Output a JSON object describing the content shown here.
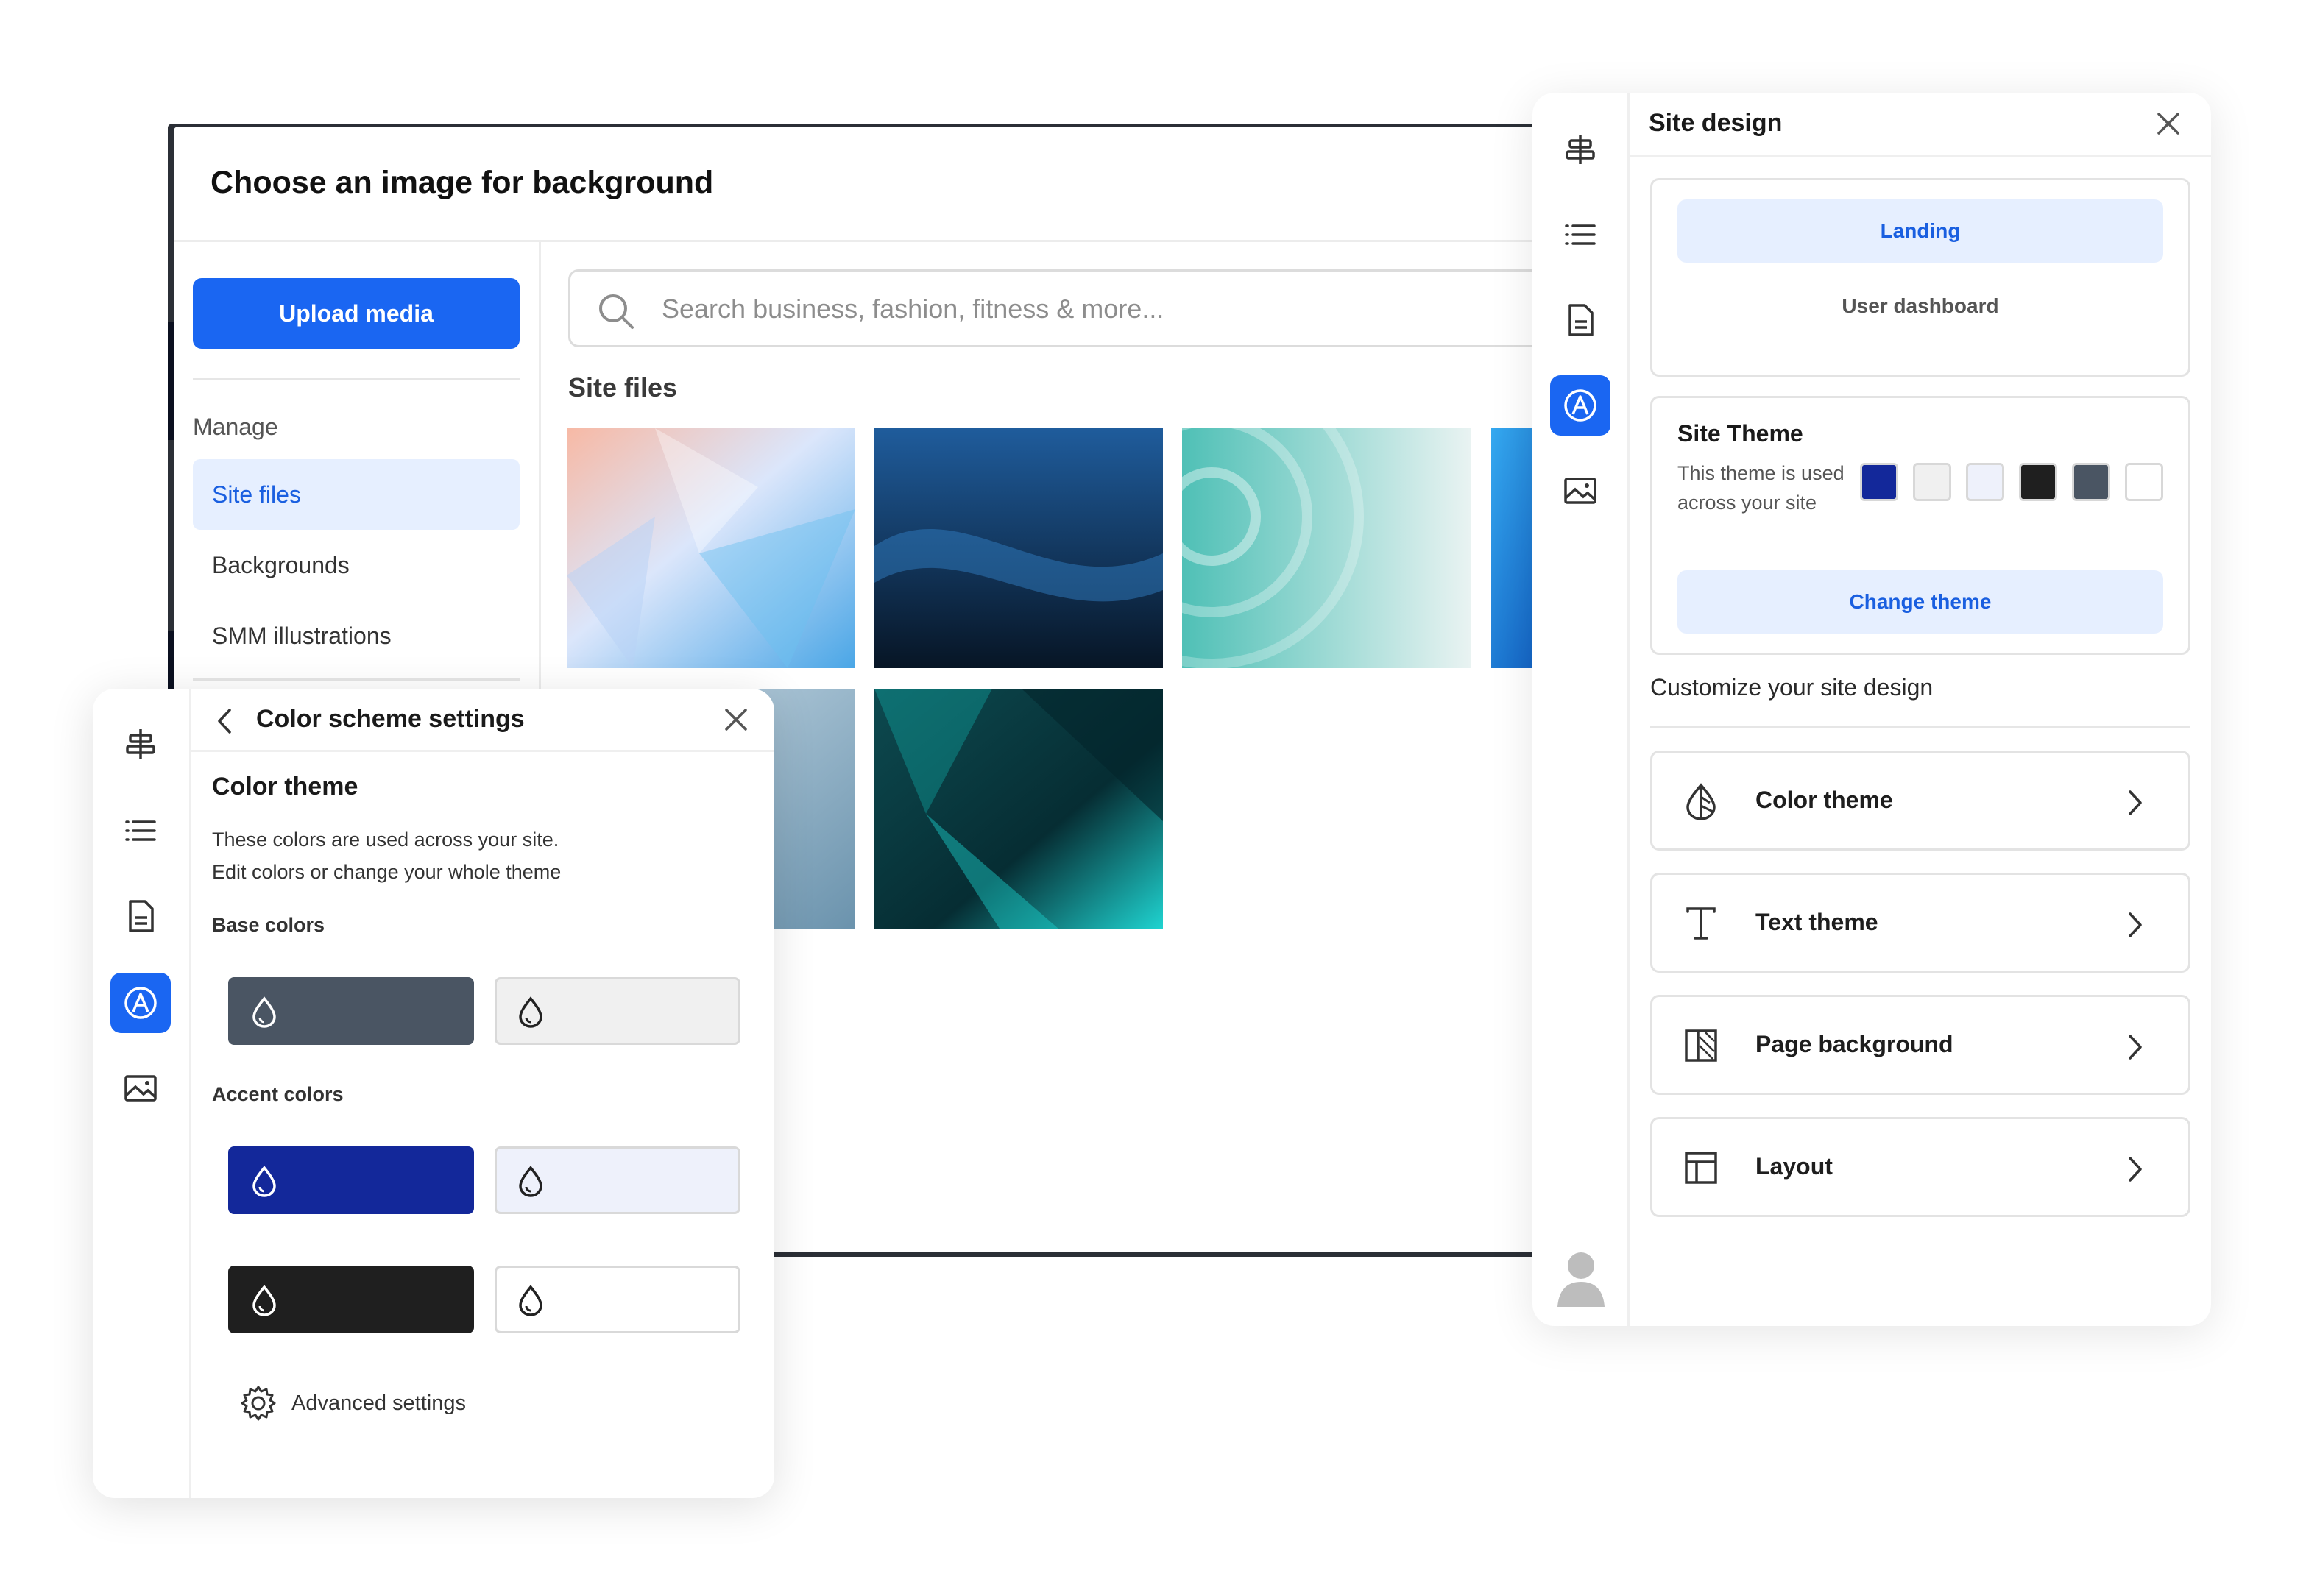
{
  "image_picker": {
    "title": "Choose an image for background",
    "upload_label": "Upload media",
    "manage_label": "Manage",
    "nav": [
      {
        "label": "Site files",
        "active": true
      },
      {
        "label": "Backgrounds",
        "active": false
      },
      {
        "label": "SMM illustrations",
        "active": false
      }
    ],
    "search_placeholder": "Search business, fashion, fitness & more...",
    "section_title": "Site files"
  },
  "site_design": {
    "title": "Site design",
    "pages": {
      "landing": "Landing",
      "dashboard": "User dashboard"
    },
    "theme": {
      "title": "Site Theme",
      "description": "This theme is used across your site",
      "change_label": "Change theme",
      "swatches": [
        "#13289a",
        "#f0f0f0",
        "#eef1fb",
        "#1f1f1f",
        "#4a5563",
        "#ffffff"
      ]
    },
    "customize_label": "Customize your site design",
    "options": [
      {
        "label": "Color theme",
        "icon": "color-drop-icon"
      },
      {
        "label": "Text theme",
        "icon": "text-icon"
      },
      {
        "label": "Page background",
        "icon": "page-background-icon"
      },
      {
        "label": "Layout",
        "icon": "layout-icon"
      }
    ]
  },
  "color_scheme": {
    "title": "Color scheme settings",
    "heading": "Color theme",
    "description_line1": "These colors are used across your site.",
    "description_line2": "Edit colors or change your whole theme",
    "base_label": "Base colors",
    "accent_label": "Accent colors",
    "base_colors": [
      "#4a5563",
      "#f0f0f0"
    ],
    "accent_colors": [
      "#13289a",
      "#eef1fb",
      "#1f1f1f",
      "#ffffff"
    ],
    "advanced_label": "Advanced settings"
  },
  "colors": {
    "accent": "#1a66f2",
    "active_bg": "#e6efff"
  }
}
